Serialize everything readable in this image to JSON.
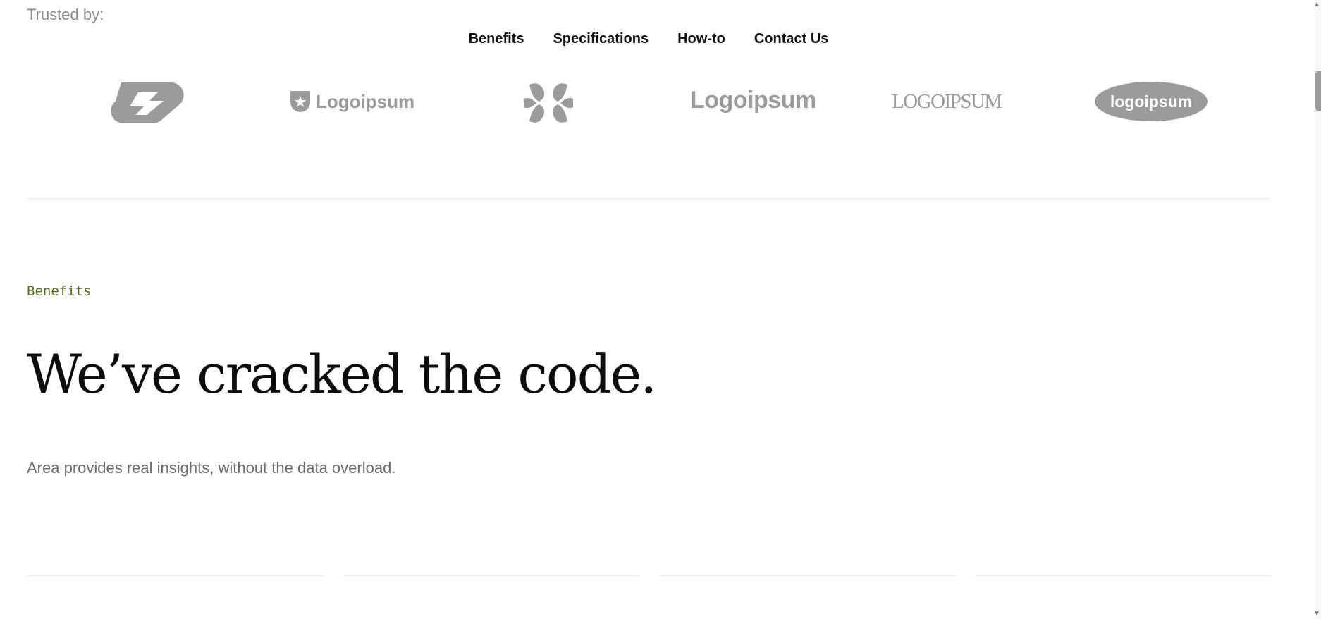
{
  "trusted": {
    "label": "Trusted by:"
  },
  "nav": {
    "items": [
      {
        "label": "Benefits"
      },
      {
        "label": "Specifications"
      },
      {
        "label": "How-to"
      },
      {
        "label": "Contact Us"
      }
    ]
  },
  "logos": [
    {
      "name": "abstract-chain-logo",
      "text": ""
    },
    {
      "name": "shield-wordmark-logo",
      "text": "Logoipsum"
    },
    {
      "name": "petal-mark-logo",
      "text": ""
    },
    {
      "name": "bold-wordmark-logo",
      "text": "Logoipsum"
    },
    {
      "name": "serif-wordmark-logo",
      "text": "LOGOIPSUM"
    },
    {
      "name": "oval-badge-logo",
      "text": "logoipsum"
    }
  ],
  "benefits": {
    "eyebrow": "Benefits",
    "headline": "We’ve cracked the code.",
    "subtext": "Area provides real insights, without the data overload."
  },
  "colors": {
    "logo_gray": "#9b9b9b",
    "eyebrow_green": "#4f6a1a",
    "divider": "#ebebeb"
  }
}
